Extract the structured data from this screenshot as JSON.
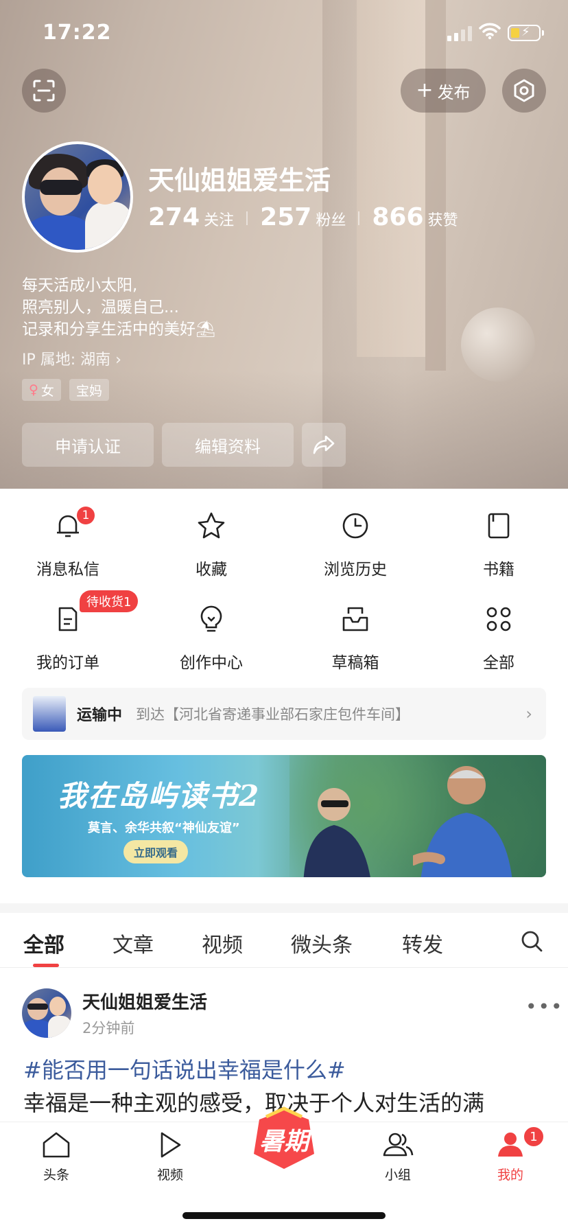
{
  "status_bar": {
    "time": "17:22"
  },
  "header": {
    "publish_label": "发布"
  },
  "profile": {
    "nickname": "天仙姐姐爱生活",
    "following_count": "274",
    "following_label": "关注",
    "fans_count": "257",
    "fans_label": "粉丝",
    "likes_count": "866",
    "likes_label": "获赞",
    "bio_line1": "每天活成小太阳,",
    "bio_line2": "照亮别人，温暖自己...",
    "bio_line3": "记录和分享生活中的美好⛱",
    "ip_location": "IP 属地: 湖南",
    "tags": [
      "女",
      "宝妈"
    ],
    "apply_verify_label": "申请认证",
    "edit_profile_label": "编辑资料"
  },
  "shortcuts": [
    {
      "label": "消息私信",
      "icon": "bell-icon",
      "badge": "1"
    },
    {
      "label": "收藏",
      "icon": "star-icon"
    },
    {
      "label": "浏览历史",
      "icon": "clock-icon"
    },
    {
      "label": "书籍",
      "icon": "book-icon"
    },
    {
      "label": "我的订单",
      "icon": "order-icon",
      "badge": "待收货1"
    },
    {
      "label": "创作中心",
      "icon": "bulb-icon"
    },
    {
      "label": "草稿箱",
      "icon": "draft-icon"
    },
    {
      "label": "全部",
      "icon": "grid-icon"
    }
  ],
  "shipping": {
    "status": "运输中",
    "detail": "到达【河北省寄递事业部石家庄包件车间】"
  },
  "banner": {
    "title": "我在岛屿读书2",
    "subtitle": "莫言、余华共叙“神仙友谊”",
    "button": "立即观看"
  },
  "content_tabs": [
    "全部",
    "文章",
    "视频",
    "微头条",
    "转发"
  ],
  "post": {
    "author": "天仙姐姐爱生活",
    "time": "2分钟前",
    "topic": "#能否用一句话说出幸福是什么#",
    "body": "幸福是一种主观的感受，取决于个人对生活的满"
  },
  "bottom_nav": [
    {
      "label": "头条",
      "icon": "home-icon"
    },
    {
      "label": "视频",
      "icon": "play-icon"
    },
    {
      "label": "暑期",
      "icon": "summer-promo-icon"
    },
    {
      "label": "小组",
      "icon": "group-icon"
    },
    {
      "label": "我的",
      "icon": "user-icon",
      "badge": "1"
    }
  ],
  "colors": {
    "accent": "#f04142",
    "topic": "#3b5b9c"
  }
}
